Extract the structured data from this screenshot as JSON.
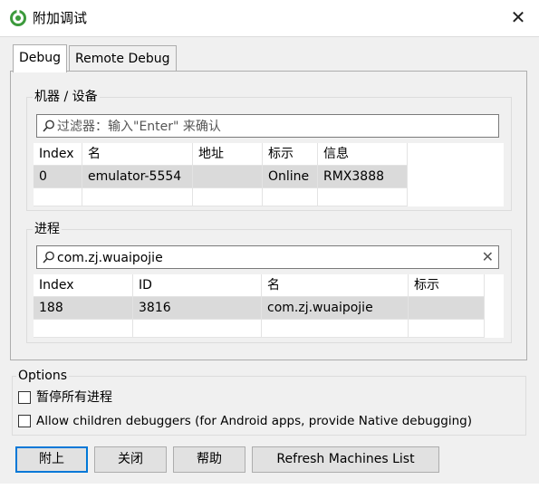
{
  "window": {
    "title": "附加调试",
    "close_glyph": "✕"
  },
  "tabs": [
    {
      "label": "Debug"
    },
    {
      "label": "Remote Debug"
    }
  ],
  "machines": {
    "group_label": "机器 / 设备",
    "filter_placeholder": "过滤器：输入\"Enter\" 来确认",
    "columns": [
      "Index",
      "名",
      "地址",
      "标示",
      "信息"
    ],
    "rows": [
      [
        "0",
        "emulator-5554",
        "",
        "Online",
        "RMX3888"
      ]
    ]
  },
  "processes": {
    "group_label": "进程",
    "filter_value": "com.zj.wuaipojie",
    "clear_glyph": "✕",
    "columns": [
      "Index",
      "ID",
      "名",
      "标示"
    ],
    "rows": [
      [
        "188",
        "3816",
        "com.zj.wuaipojie",
        ""
      ]
    ]
  },
  "options": {
    "group_label": "Options",
    "pause_all_label": "暂停所有进程",
    "allow_children_label": "Allow children debuggers (for Android apps, provide Native debugging)"
  },
  "buttons": {
    "attach": "附上",
    "close": "关闭",
    "help": "帮助",
    "refresh": "Refresh Machines List"
  },
  "colors": {
    "accent": "#0078d7",
    "app_icon": "#3c9a3c",
    "selected_row": "#dadada"
  },
  "icons": {
    "app": "android-studio-icon",
    "search": "magnifier-icon",
    "close": "close-icon",
    "clear": "clear-icon"
  }
}
